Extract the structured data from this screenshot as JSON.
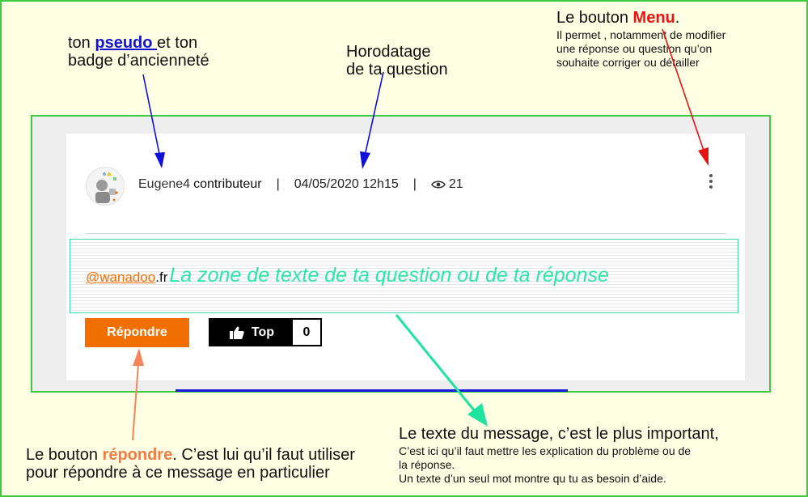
{
  "annotations": {
    "pseudo": {
      "line1_prefix": "ton ",
      "line1_highlight": "pseudo ",
      "line1_suffix": "et ton",
      "line2": "badge d’ancienneté"
    },
    "horodatage": {
      "line1": "Horodatage",
      "line2": "de ta question"
    },
    "menu": {
      "title_prefix": "Le bouton ",
      "title_highlight": "Menu",
      "title_suffix": ".",
      "line1": "Il permet , notamment de modifier",
      "line2": "une réponse ou question qu’on",
      "line3": "souhaite corriger ou détailler"
    },
    "message": {
      "title": "Le texte du message, c’est le plus important,",
      "line1": "C’est ici qu’il faut mettre les explication du problème ou de",
      "line2": "la réponse.",
      "line3": "Un texte d’un seul mot montre qu tu as besoin d’aide."
    },
    "repondre": {
      "line1_prefix": "Le bouton ",
      "line1_highlight": "répondre",
      "line1_suffix": ". C’est lui qu’il faut utiliser",
      "line2": "pour répondre à ce message en particulier"
    }
  },
  "post": {
    "username": "Eugene4",
    "badge": "contributeur",
    "separator": "|",
    "timestamp": "04/05/2020 12h15",
    "views": "21",
    "mention": "@wanadoo",
    "mention_suffix": ".fr",
    "body_placeholder": "La zone de texte de ta question ou de ta réponse",
    "reply_label": "Répondre",
    "top_label": "Top",
    "top_count": "0"
  },
  "colors": {
    "frame_green": "#3ecb3e",
    "orange": "#f16e00",
    "arrow_blue": "#1010d8",
    "arrow_red": "#e61212",
    "arrow_teal": "#20e3a0",
    "arrow_salmon": "#f4845a",
    "menu_highlight": "#ee1111",
    "pseudo_highlight": "#1313d6"
  },
  "icons": {
    "avatar": "robot-avatar-icon",
    "views": "eye-icon",
    "menu": "vertical-dots-icon",
    "top": "thumbs-up-icon"
  }
}
